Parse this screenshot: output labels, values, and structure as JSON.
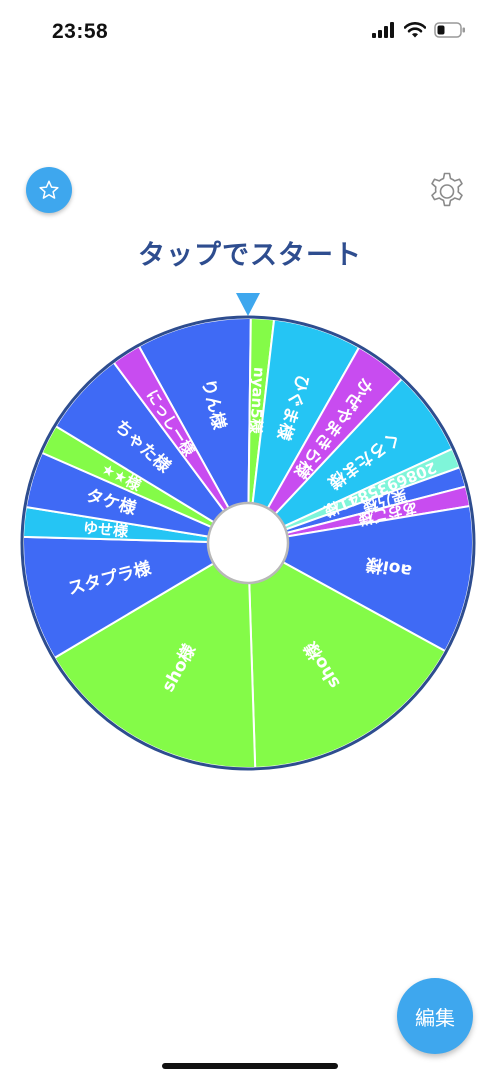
{
  "status_bar": {
    "time": "23:58"
  },
  "header": {
    "start_label": "タップでスタート"
  },
  "footer": {
    "edit_label": "編集"
  },
  "colors": {
    "accent": "#3ea7ee",
    "title": "#2e4d8f",
    "wheel_border": "#2e4d8f",
    "pointer": "#3ea7ee",
    "blue": "#3f6af5",
    "green": "#84fb48",
    "cyan": "#25c5f4",
    "purple": "#c84cf0",
    "mint": "#7ff5d9"
  },
  "wheel": {
    "pointer_icon": "triangle-down-icon",
    "segments": [
      {
        "label": "りん様",
        "color": "#3f6af5",
        "weight": 3.5
      },
      {
        "label": "nyan5様",
        "color": "#84fb48",
        "weight": 0.7
      },
      {
        "label": "ひぐま様",
        "color": "#25c5f4",
        "weight": 2.7
      },
      {
        "label": "かぜやまきら様",
        "color": "#c84cf0",
        "weight": 1.6
      },
      {
        "label": "くろたま様",
        "color": "#25c5f4",
        "weight": 2.6
      },
      {
        "label": "2086935841様",
        "color": "#7ff5d9",
        "weight": 0.6
      },
      {
        "label": "栗乃様",
        "color": "#3f6af5",
        "weight": 0.6
      },
      {
        "label": "あおご様",
        "color": "#c84cf0",
        "weight": 0.6
      },
      {
        "label": "aoi様",
        "color": "#3f6af5",
        "weight": 4.5
      },
      {
        "label": "sho様",
        "color": "#84fb48",
        "weight": 7.0
      },
      {
        "label": "sho様",
        "color": "#84fb48",
        "weight": 7.2
      },
      {
        "label": "スタプラ様",
        "color": "#3f6af5",
        "weight": 3.8
      },
      {
        "label": "ゆせ様",
        "color": "#25c5f4",
        "weight": 0.9
      },
      {
        "label": "タケ様",
        "color": "#3f6af5",
        "weight": 1.7
      },
      {
        "label": "★★様",
        "color": "#84fb48",
        "weight": 0.9
      },
      {
        "label": "ちゃた様",
        "color": "#3f6af5",
        "weight": 2.6
      },
      {
        "label": "にっしー様",
        "color": "#c84cf0",
        "weight": 0.9
      }
    ]
  }
}
